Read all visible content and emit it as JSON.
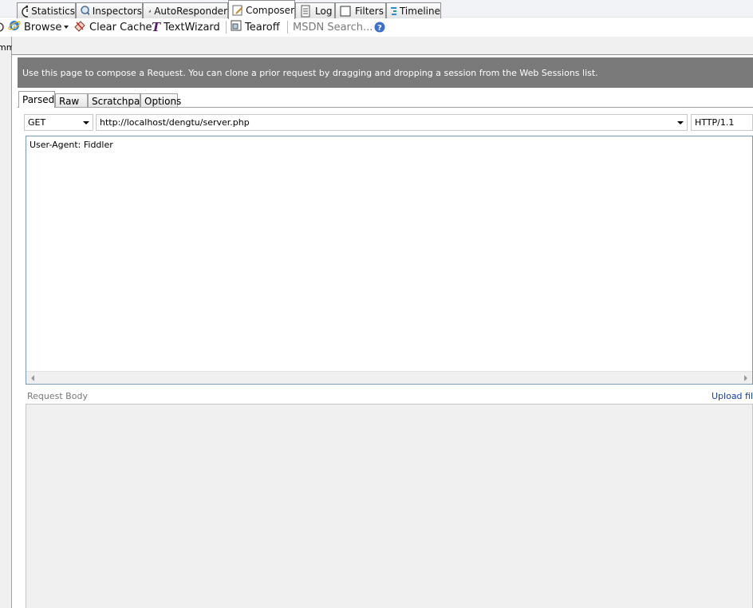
{
  "toolbar": {
    "browse": "Browse",
    "clear_cache": "Clear Cache",
    "textwizard": "TextWizard",
    "tearoff": "Tearoff",
    "msdn_search": "MSDN Search..."
  },
  "left_panel": {
    "clipped_text": "mm"
  },
  "tabs": {
    "statistics": "Statistics",
    "inspectors": "Inspectors",
    "autoresponder": "AutoResponder",
    "composer": "Composer",
    "log": "Log",
    "filters": "Filters",
    "timeline": "Timeline"
  },
  "banner": "Use this page to compose a Request. You can clone a prior request by dragging and dropping a session from the Web Sessions list.",
  "subtabs": {
    "parsed": "Parsed",
    "raw": "Raw",
    "scratchpad": "Scratchpad",
    "options": "Options"
  },
  "request": {
    "method": "GET",
    "url": "http://localhost/dengtu/server.php",
    "version": "HTTP/1.1"
  },
  "headers_text": "User-Agent: Fiddler",
  "body": {
    "label": "Request Body",
    "upload_link": "Upload file"
  },
  "colors": {
    "banner_bg": "#7a7a7a",
    "link": "#1a3ea8"
  }
}
